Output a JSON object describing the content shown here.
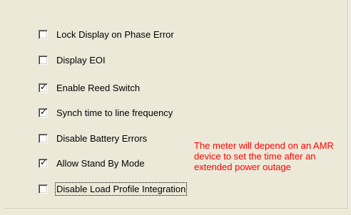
{
  "options": [
    {
      "label": "Lock Display on Phase Error",
      "checked": false
    },
    {
      "label": "Display EOI",
      "checked": false
    },
    {
      "label": "Enable Reed Switch",
      "checked": true
    },
    {
      "label": "Synch time to line frequency",
      "checked": true
    },
    {
      "label": "Disable Battery Errors",
      "checked": false
    },
    {
      "label": "Allow Stand By Mode",
      "checked": true
    },
    {
      "label": "Disable Load Profile Integration",
      "checked": false
    }
  ],
  "note": {
    "text": "The meter will depend on an AMR device to set the time after an extended power outage",
    "color": "#ff0000"
  },
  "check_glyph": "✓"
}
